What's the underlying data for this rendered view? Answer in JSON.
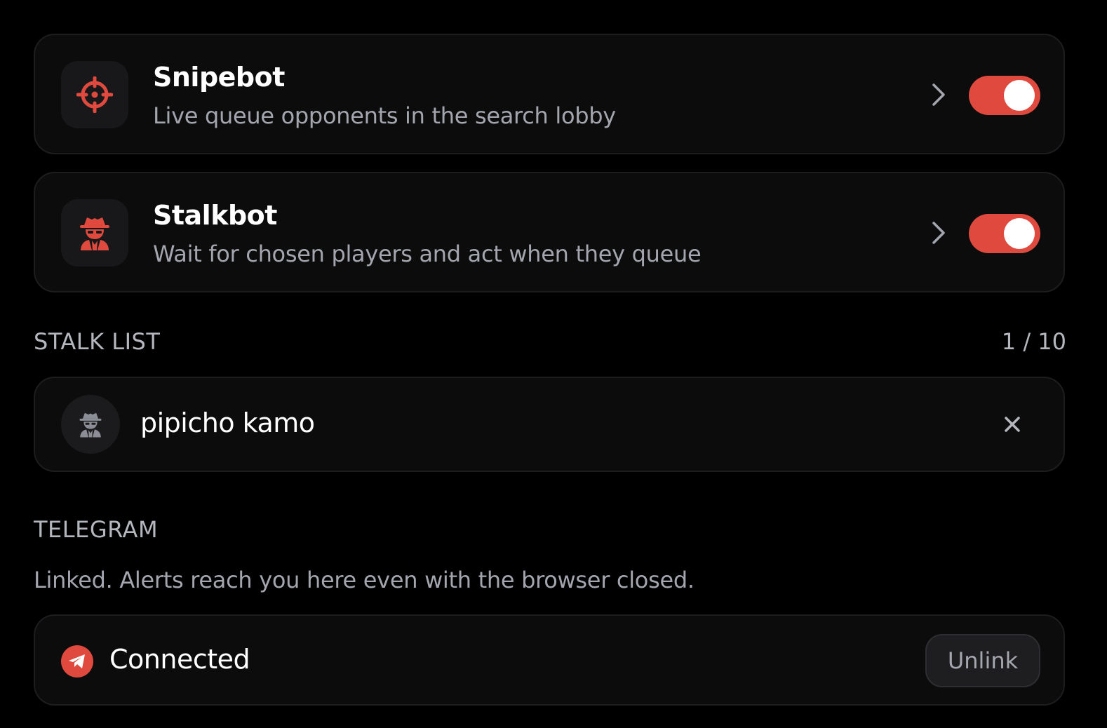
{
  "bots": [
    {
      "title": "Snipebot",
      "description": "Live queue opponents in the search lobby",
      "icon": "crosshair-icon",
      "enabled": true
    },
    {
      "title": "Stalkbot",
      "description": "Wait for chosen players and act when they queue",
      "icon": "spy-icon",
      "enabled": true
    }
  ],
  "stalk_list": {
    "label": "STALK LIST",
    "count": "1 / 10",
    "items": [
      {
        "name": "pipicho kamo",
        "icon": "spy-icon"
      }
    ]
  },
  "telegram": {
    "label": "TELEGRAM",
    "description": "Linked. Alerts reach you here even with the browser closed.",
    "status": "Connected",
    "icon": "telegram-icon",
    "unlink_label": "Unlink"
  },
  "colors": {
    "accent": "#e04a3e",
    "background": "#000000",
    "card": "#0c0c0d",
    "muted_text": "#a3a6ae"
  }
}
